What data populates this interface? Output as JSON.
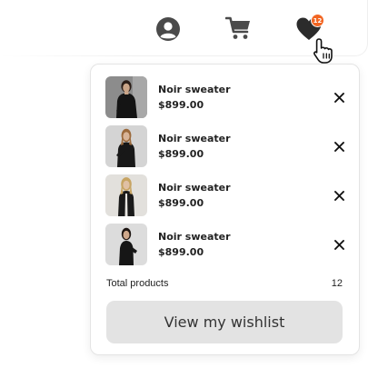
{
  "header": {
    "icons": [
      "user-circle-icon",
      "shopping-cart-icon",
      "heart-icon"
    ],
    "wishlist_badge": "12"
  },
  "wishlist": {
    "items": [
      {
        "name": "Noir sweater",
        "price": "$899.00",
        "thumb_icon": "product-image"
      },
      {
        "name": "Noir sweater",
        "price": "$899.00",
        "thumb_icon": "product-image"
      },
      {
        "name": "Noir sweater",
        "price": "$899.00",
        "thumb_icon": "product-image"
      },
      {
        "name": "Noir sweater",
        "price": "$899.00",
        "thumb_icon": "product-image"
      }
    ],
    "remove_icon": "close-icon",
    "total_label": "Total products",
    "total_count": "12",
    "view_button": "View my wishlist"
  },
  "colors": {
    "accent": "#f26522",
    "icon": "#4a4a4a",
    "button_bg": "#e3e3e3",
    "text": "#222222"
  }
}
